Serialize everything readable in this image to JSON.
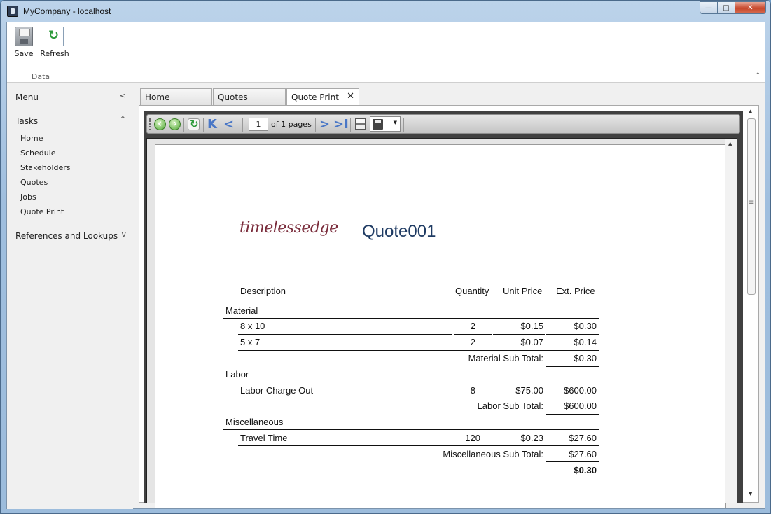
{
  "window": {
    "title": "MyCompany - localhost",
    "controls": {
      "minimize": "—",
      "maximize": "□",
      "close": "✕"
    }
  },
  "ribbon": {
    "save_label": "Save",
    "refresh_label": "Refresh",
    "group_label": "Data",
    "collapse_glyph": "^"
  },
  "sidebar": {
    "menu_label": "Menu",
    "menu_chevron": "<",
    "tasks_label": "Tasks",
    "tasks_chevron": "^",
    "items": [
      "Home",
      "Schedule",
      "Stakeholders",
      "Quotes",
      "Jobs",
      "Quote Print"
    ],
    "references_label": "References and Lookups",
    "references_chevron": "v"
  },
  "tabs": [
    {
      "label": "Home"
    },
    {
      "label": "Quotes"
    },
    {
      "label": "Quote Print",
      "close": "✕"
    }
  ],
  "viewer": {
    "page_number": "1",
    "page_of": "of 1 pages",
    "nav_first": "K",
    "nav_prev": "<",
    "nav_next": ">",
    "nav_last": ">I"
  },
  "report": {
    "logo_text": "timelessedge",
    "quote_id": "Quote001",
    "headers": {
      "description": "Description",
      "quantity": "Quantity",
      "unit_price": "Unit Price",
      "ext_price": "Ext. Price"
    },
    "sections": [
      {
        "name": "Material",
        "rows": [
          {
            "description": "8 x 10",
            "quantity": "2",
            "unit_price": "$0.15",
            "ext_price": "$0.30"
          },
          {
            "description": "5 x 7",
            "quantity": "2",
            "unit_price": "$0.07",
            "ext_price": "$0.14"
          }
        ],
        "subtotal_label": "Material Sub Total:",
        "subtotal": "$0.30"
      },
      {
        "name": "Labor",
        "rows": [
          {
            "description": "Labor Charge Out",
            "quantity": "8",
            "unit_price": "$75.00",
            "ext_price": "$600.00"
          }
        ],
        "subtotal_label": "Labor Sub Total:",
        "subtotal": "$600.00"
      },
      {
        "name": "Miscellaneous",
        "rows": [
          {
            "description": "Travel Time",
            "quantity": "120",
            "unit_price": "$0.23",
            "ext_price": "$27.60"
          }
        ],
        "subtotal_label": "Miscellaneous Sub Total:",
        "subtotal": "$27.60"
      }
    ],
    "grand_total": "$0.30"
  }
}
